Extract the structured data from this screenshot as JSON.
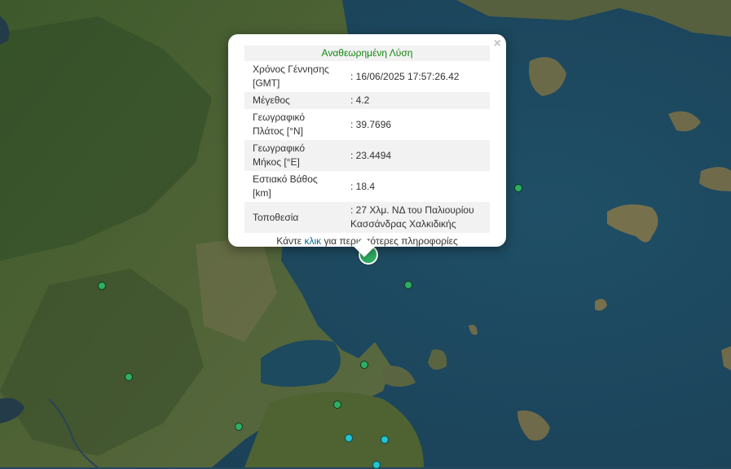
{
  "popup": {
    "title": "Αναθεωρημένη Λύση",
    "close_symbol": "×",
    "rows": [
      {
        "label": "Χρόνος Γέννησης [GMT]",
        "value": ": 16/06/2025 17:57:26.42"
      },
      {
        "label": "Μέγεθος",
        "value": ": 4.2"
      },
      {
        "label": "Γεωγραφικό Πλάτος [°N]",
        "value": ": 39.7696"
      },
      {
        "label": "Γεωγραφικό Μήκος [°E]",
        "value": ": 23.4494"
      },
      {
        "label": "Εστιακό Βάθος [km]",
        "value": ": 18.4"
      },
      {
        "label": "Τοποθεσία",
        "value": ": 27 Χλμ. ΝΔ του Παλιουρίου Κασσάνδρας Χαλκιδικής"
      }
    ],
    "more_prefix": "Κάντε ",
    "more_link": "κλικ",
    "more_suffix": " για περισσότερες πληροφορίες"
  },
  "colors": {
    "marker_green": "#2fae63",
    "marker_cyan": "#23c3d4",
    "title_green": "#118811",
    "link": "#0b6a91"
  }
}
